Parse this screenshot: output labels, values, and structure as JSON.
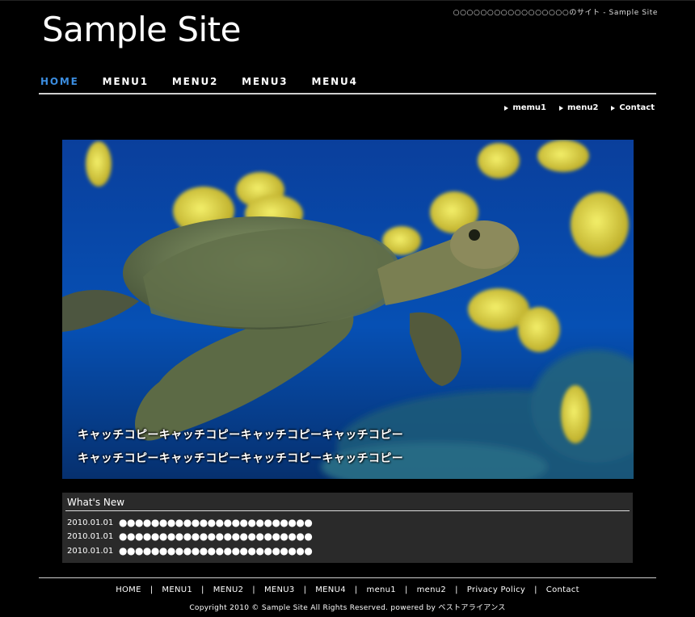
{
  "header": {
    "tagline": "○○○○○○○○○○○○○○○○○のサイト - Sample Site",
    "logo": "Sample Site"
  },
  "global_nav": [
    {
      "label": "HOME",
      "active": true
    },
    {
      "label": "MENU1",
      "active": false
    },
    {
      "label": "MENU2",
      "active": false
    },
    {
      "label": "MENU3",
      "active": false
    },
    {
      "label": "MENU4",
      "active": false
    }
  ],
  "sub_nav": [
    "memu1",
    "menu2",
    "Contact"
  ],
  "hero": {
    "catch_line1": "キャッチコピーキャッチコピーキャッチコピーキャッチコピー",
    "catch_line2": "キャッチコピーキャッチコピーキャッチコピーキャッチコピー"
  },
  "news": {
    "title": "What's New",
    "items": [
      {
        "date": "2010.01.01",
        "text": "●●●●●●●●●●●●●●●●●●●●●●●●"
      },
      {
        "date": "2010.01.01",
        "text": "●●●●●●●●●●●●●●●●●●●●●●●●"
      },
      {
        "date": "2010.01.01",
        "text": "●●●●●●●●●●●●●●●●●●●●●●●●"
      }
    ]
  },
  "footer": {
    "nav": [
      "HOME",
      "MENU1",
      "MENU2",
      "MENU3",
      "MENU4",
      "menu1",
      "menu2",
      "Privacy Policy",
      "Contact"
    ],
    "separator": "|",
    "copyright": "Copyright 2010 © Sample Site All Rights Reserved.  powered by ベストアライアンス"
  },
  "colors": {
    "background": "#000000",
    "active_nav": "#3b8de0",
    "news_panel": "#2a2a2a"
  }
}
